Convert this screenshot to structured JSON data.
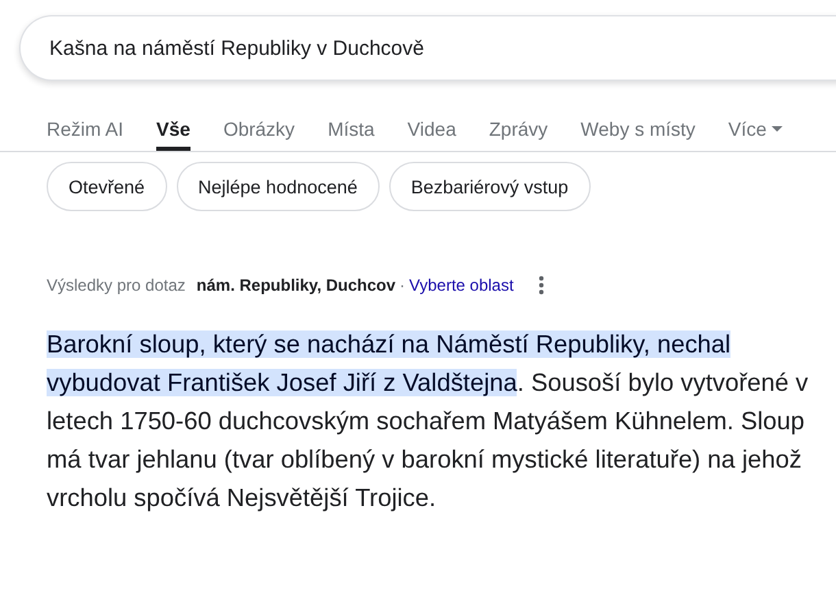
{
  "search": {
    "value": "Kašna na náměstí Republiky v Duchcově"
  },
  "tabs": [
    {
      "label": "Režim AI",
      "selected": false
    },
    {
      "label": "Vše",
      "selected": true
    },
    {
      "label": "Obrázky",
      "selected": false
    },
    {
      "label": "Místa",
      "selected": false
    },
    {
      "label": "Videa",
      "selected": false
    },
    {
      "label": "Zprávy",
      "selected": false
    },
    {
      "label": "Weby s místy",
      "selected": false
    },
    {
      "label": "Více",
      "selected": false,
      "kind": "menu"
    }
  ],
  "chips": [
    "Otevřené",
    "Nejlépe hodnocené",
    "Bezbariérový vstup"
  ],
  "location": {
    "prefix": "Výsledky pro dotaz",
    "place": "nám. Republiky, Duchcov",
    "separator": "·",
    "link": "Vyberte oblast"
  },
  "snippet": {
    "highlight": "Barokní sloup, který se nachází na Náměstí Republiky, nechal vybudovat František Josef Jiří z Valdštejna",
    "rest": ". Sousoší bylo vytvořené v letech 1750-60 duchcovským sochařem Matyášem Kühnelem. Sloup má tvar jehlanu (tvar oblíbený v barokní mystické literatuře) na jehož vrcholu spočívá Nejsvětější Trojice."
  }
}
